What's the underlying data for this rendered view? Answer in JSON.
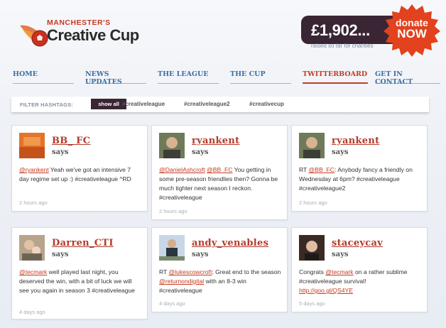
{
  "header": {
    "logo_small": "MANCHESTER'S",
    "logo_big": "Creative Cup",
    "amount": "£1,902...",
    "raised_text": "raised so far for charities",
    "donate_line1": "donate",
    "donate_line2": "NOW"
  },
  "nav": [
    "HOME",
    "NEWS UPDATES",
    "THE LEAGUE",
    "THE CUP",
    "TWITTERBOARD",
    "GET IN CONTACT"
  ],
  "nav_active": "TWITTERBOARD",
  "filter": {
    "label": "FILTER HASHTAGS:",
    "active": "show all",
    "tags": [
      "#creativeleague",
      "#creativeleague2",
      "#creativecup"
    ]
  },
  "says": "says",
  "tweets": [
    {
      "user": "BB_ FC",
      "mention": "@ryankent",
      "text": " Yeah we've got an intensive 7 day regime set up :) #creativeleague ^RD",
      "time": "2 hours ago"
    },
    {
      "user": "ryankent",
      "mention": "@DanielAshcroft",
      "mention2": "@BB_FC",
      "text": " You getting in some pre-season friendlies then? Gonna be much tighter next season I reckon. #creativeleague",
      "time": "2 hours ago"
    },
    {
      "user": "ryankent",
      "prefix": "RT ",
      "mention": "@BB_FC",
      "text": ": Anybody fancy a friendly on Wednesday at 6pm? #creativeleague #creativeleague2",
      "time": "2 hours ago"
    },
    {
      "user": "Darren_CTI",
      "mention": "@tecmark",
      "text": " well played last night, you deserved the win, with a bit of luck we will see you again in season 3 #creativeleague",
      "time": "4 days ago"
    },
    {
      "user": "andy_venables",
      "prefix": "RT ",
      "mention": "@lukescowcroft",
      "text_mid": ": Great end to the season ",
      "mention2": "@returnondigital",
      "text": " with an 8-3 win #creativeleague",
      "time": "4 days ago"
    },
    {
      "user": "staceycav",
      "prefix": "Congrats ",
      "mention": "@tecmark",
      "text": " on a rather sublime #creativeleague survival! ",
      "link": "http://goo.gl/QS4YE",
      "time": "5 days ago"
    }
  ],
  "colors": {
    "accent": "#c63a20",
    "nav": "#3a6ea5",
    "dark": "#3a2535"
  }
}
